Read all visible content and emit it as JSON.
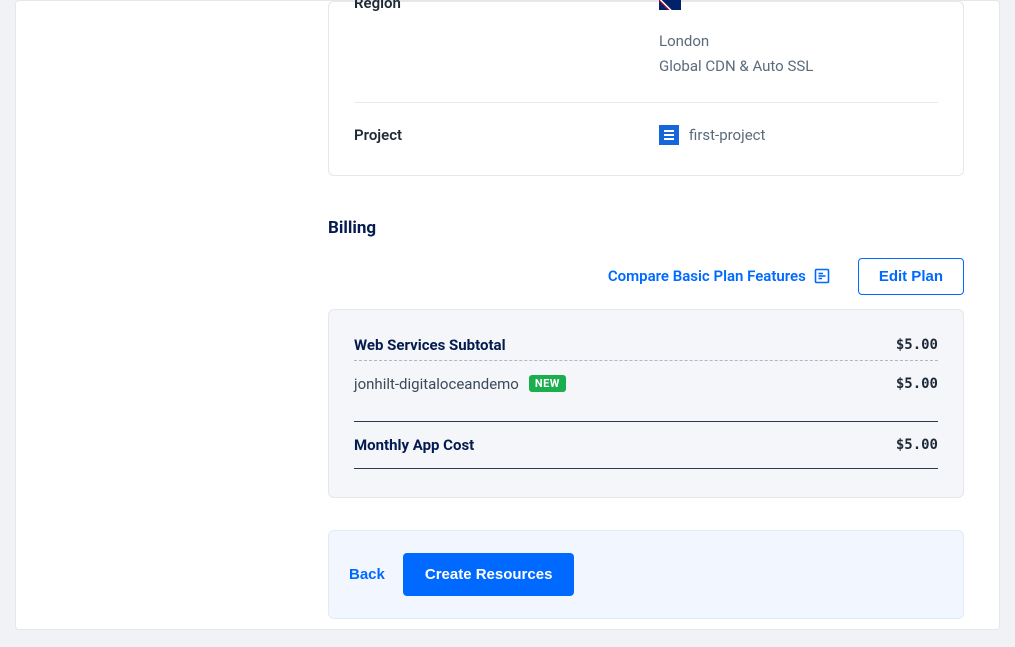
{
  "region": {
    "label": "Region",
    "city": "London",
    "cdn": "Global CDN & Auto SSL"
  },
  "project": {
    "label": "Project",
    "name": "first-project"
  },
  "billing": {
    "title": "Billing",
    "compare_label": "Compare Basic Plan Features",
    "edit_label": "Edit Plan",
    "subtotal_label": "Web Services Subtotal",
    "subtotal_price": "$5.00",
    "item_name": "jonhilt-digitaloceandemo",
    "item_badge": "NEW",
    "item_price": "$5.00",
    "total_label": "Monthly App Cost",
    "total_price": "$5.00"
  },
  "footer": {
    "back": "Back",
    "create": "Create Resources"
  }
}
